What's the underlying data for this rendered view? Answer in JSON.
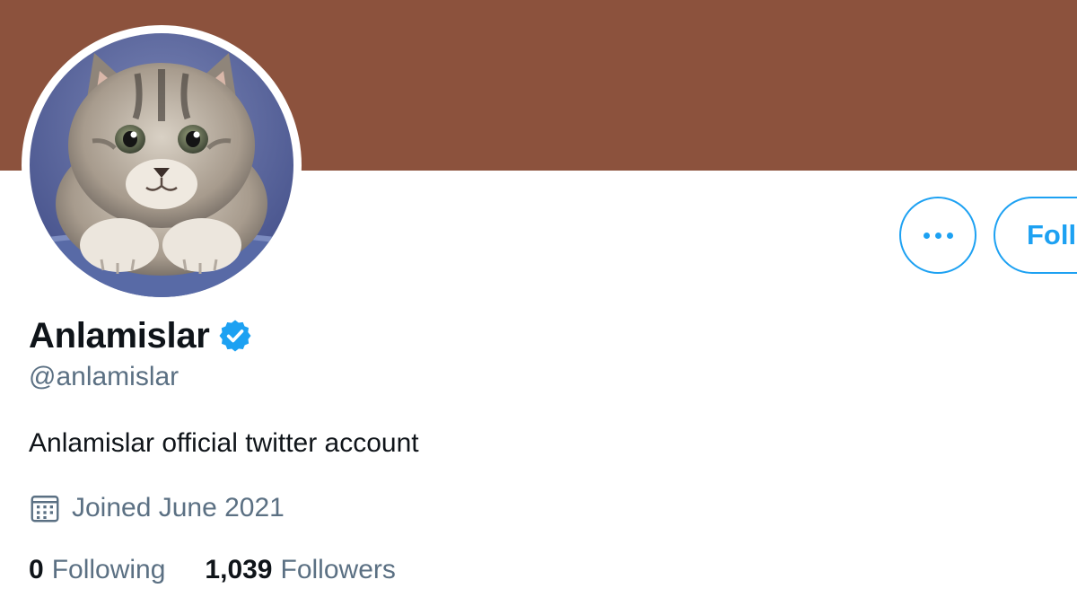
{
  "colors": {
    "banner": "#8c523d",
    "accent": "#1da1f2",
    "verified": "#1da1f2",
    "text_primary": "#0f1419",
    "text_secondary": "#5b7083"
  },
  "profile": {
    "display_name": "Anlamislar",
    "verified_icon": "verified-badge-icon",
    "handle": "@anlamislar",
    "bio": "Anlamislar official twitter account",
    "joined": "Joined June 2021",
    "joined_icon": "calendar-icon",
    "avatar": "kitten-photo"
  },
  "actions": {
    "more_icon": "more-options-icon",
    "follow_label": "Follow"
  },
  "stats": {
    "following_count": "0",
    "following_label": "Following",
    "followers_count": "1,039",
    "followers_label": "Followers"
  }
}
